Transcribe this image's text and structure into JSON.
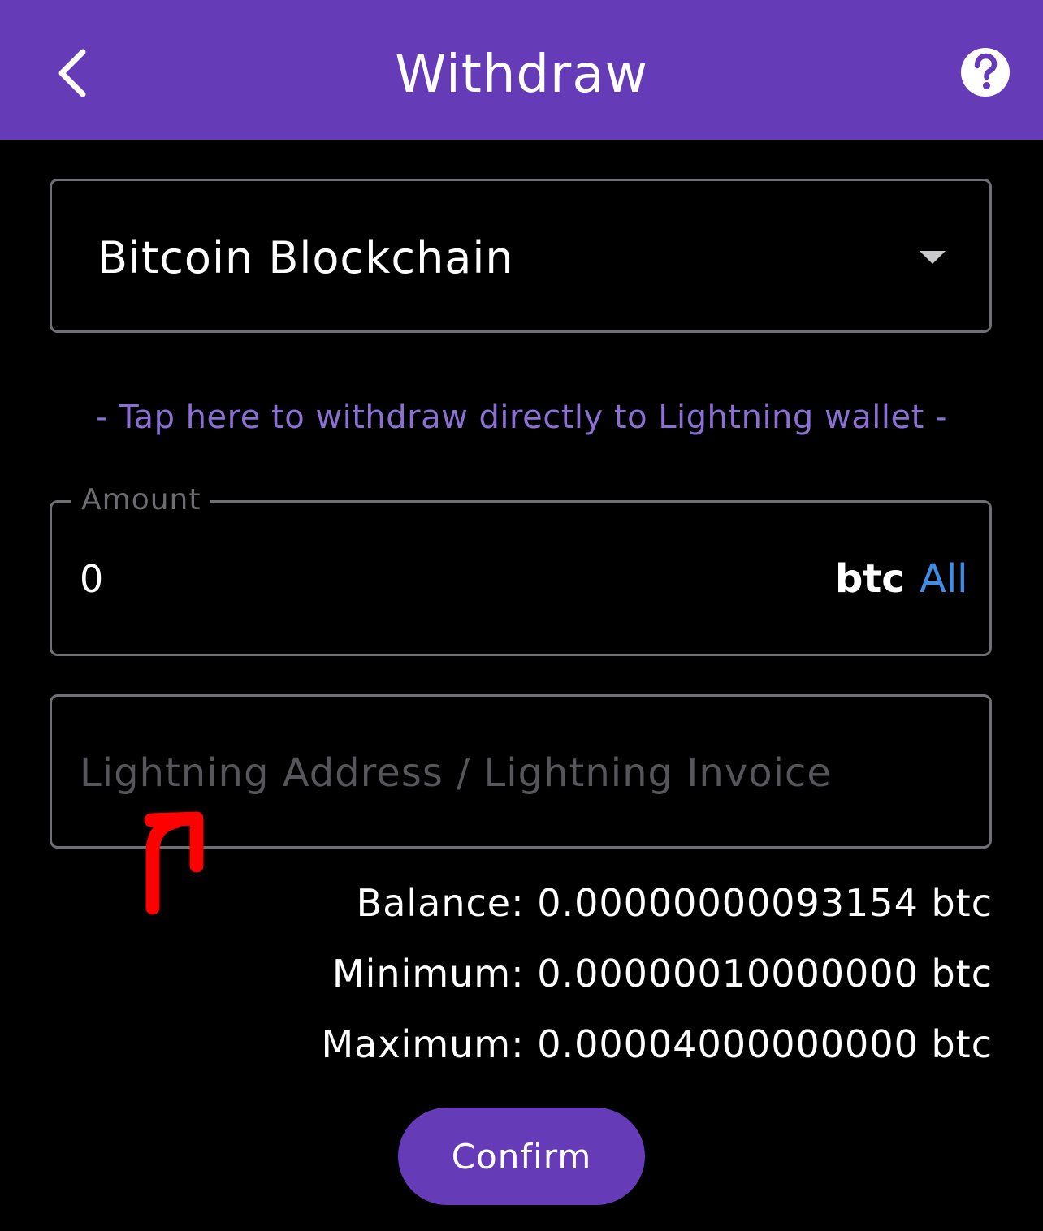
{
  "header": {
    "title": "Withdraw",
    "back_icon": "chevron-left-icon",
    "help_icon": "question-circle-icon"
  },
  "network_select": {
    "selected": "Bitcoin Blockchain",
    "icon": "caret-down-icon"
  },
  "lightning_link": "- Tap here to withdraw directly to Lightning wallet -",
  "amount": {
    "label": "Amount",
    "value": "0",
    "unit": "btc",
    "all_label": "All"
  },
  "address": {
    "placeholder": "Lightning Address / Lightning Invoice"
  },
  "limits": {
    "balance": "Balance: 0.00000000093154 btc",
    "minimum": "Minimum: 0.00000010000000 btc",
    "maximum": "Maximum: 0.00004000000000 btc"
  },
  "confirm_label": "Confirm",
  "colors": {
    "accent": "#663bb7",
    "link": "#8b6fd2",
    "all_link": "#3d8ee8",
    "annotation_arrow": "#ff0000"
  }
}
